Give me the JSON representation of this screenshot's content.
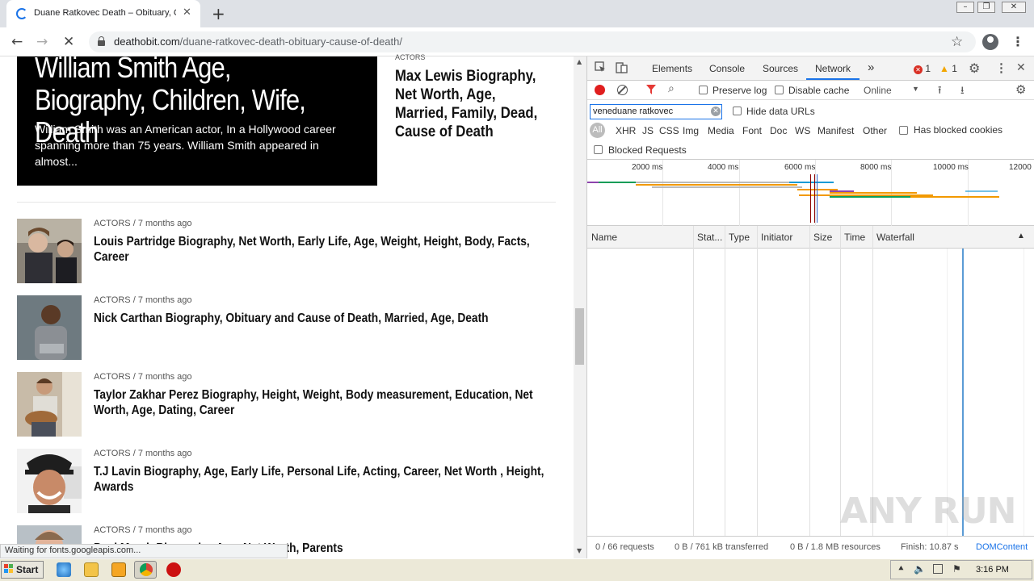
{
  "browser": {
    "tab_title": "Duane Ratkovec Death – Obituary, C",
    "tab_close": "✕",
    "new_tab": "+",
    "url_host": "deathobit.com",
    "url_path": "/duane-ratkovec-death-obituary-cause-of-death/",
    "status_text": "Waiting for fonts.googleapis.com..."
  },
  "page": {
    "hero": {
      "title": "William Smith Age, Biography, Children, Wife, Death",
      "excerpt": "William Smith was an American actor, In a Hollywood career spanning more than 75 years. William Smith appeared in almost..."
    },
    "side_article": {
      "category": "ACTORS",
      "title": "Max Lewis Biography, Net Worth, Age, Married, Family, Dead, Cause of Death"
    },
    "articles": [
      {
        "category": "ACTORS",
        "sep": "/",
        "time": "7 months ago",
        "title": "Louis Partridge Biography, Net Worth, Early Life, Age, Weight, Height, Body, Facts, Career"
      },
      {
        "category": "ACTORS",
        "sep": "/",
        "time": "7 months ago",
        "title": "Nick Carthan Biography, Obituary and Cause of Death, Married, Age, Death"
      },
      {
        "category": "ACTORS",
        "sep": "/",
        "time": "7 months ago",
        "title": "Taylor Zakhar Perez Biography, Height, Weight, Body measurement, Education, Net Worth, Age, Dating, Career"
      },
      {
        "category": "ACTORS",
        "sep": "/",
        "time": "7 months ago",
        "title": "T.J Lavin Biography, Age, Early Life, Personal Life, Acting, Career, Net Worth , Height, Awards"
      },
      {
        "category": "ACTORS",
        "sep": "/",
        "time": "7 months ago",
        "title": "Paul Marsh Biography, Age, Net Worth, Parents"
      }
    ]
  },
  "devtools": {
    "tabs": [
      "Elements",
      "Console",
      "Sources",
      "Network"
    ],
    "more": "»",
    "error_count": "1",
    "warning_count": "1",
    "toolbar": {
      "preserve_log": "Preserve log",
      "disable_cache": "Disable cache",
      "throttling": "Online"
    },
    "filter": {
      "value": "veneduane ratkovec",
      "hide_data_urls": "Hide data URLs",
      "types": [
        "All",
        "XHR",
        "JS",
        "CSS",
        "Img",
        "Media",
        "Font",
        "Doc",
        "WS",
        "Manifest",
        "Other"
      ],
      "has_blocked_cookies": "Has blocked cookies",
      "blocked_requests": "Blocked Requests"
    },
    "overview_ticks": [
      "2000 ms",
      "4000 ms",
      "6000 ms",
      "8000 ms",
      "10000 ms",
      "12000"
    ],
    "columns": [
      "Name",
      "Stat...",
      "Type",
      "Initiator",
      "Size",
      "Time",
      "Waterfall"
    ],
    "summary": {
      "requests": "0 / 66 requests",
      "transferred": "0 B / 761 kB transferred",
      "resources": "0 B / 1.8 MB resources",
      "finish": "Finish: 10.87 s",
      "domcontent": "DOMContent"
    }
  },
  "watermark": "ANY RUN",
  "taskbar": {
    "start_label": "Start",
    "clock": "3:16 PM"
  }
}
